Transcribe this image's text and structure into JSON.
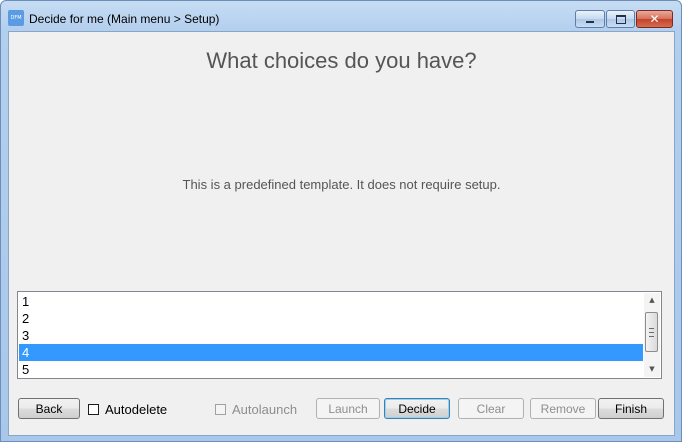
{
  "window": {
    "title": "Decide for me (Main menu > Setup)",
    "icon_text": "DFM",
    "controls": [
      "minimize-icon",
      "maximize-icon",
      "close-icon"
    ]
  },
  "page": {
    "heading": "What choices do you have?",
    "info": "This is a predefined template. It does not require setup."
  },
  "list": {
    "items": [
      "1",
      "2",
      "3",
      "4",
      "5"
    ],
    "selected": "4"
  },
  "footer": {
    "back_label": "Back",
    "autodelete_label": "Autodelete",
    "autolaunch_label": "Autolaunch",
    "launch_label": "Launch",
    "decide_label": "Decide",
    "clear_label": "Clear",
    "remove_label": "Remove",
    "finish_label": "Finish"
  },
  "colors": {
    "selection": "#3399ff",
    "text_gray": "#555555"
  }
}
